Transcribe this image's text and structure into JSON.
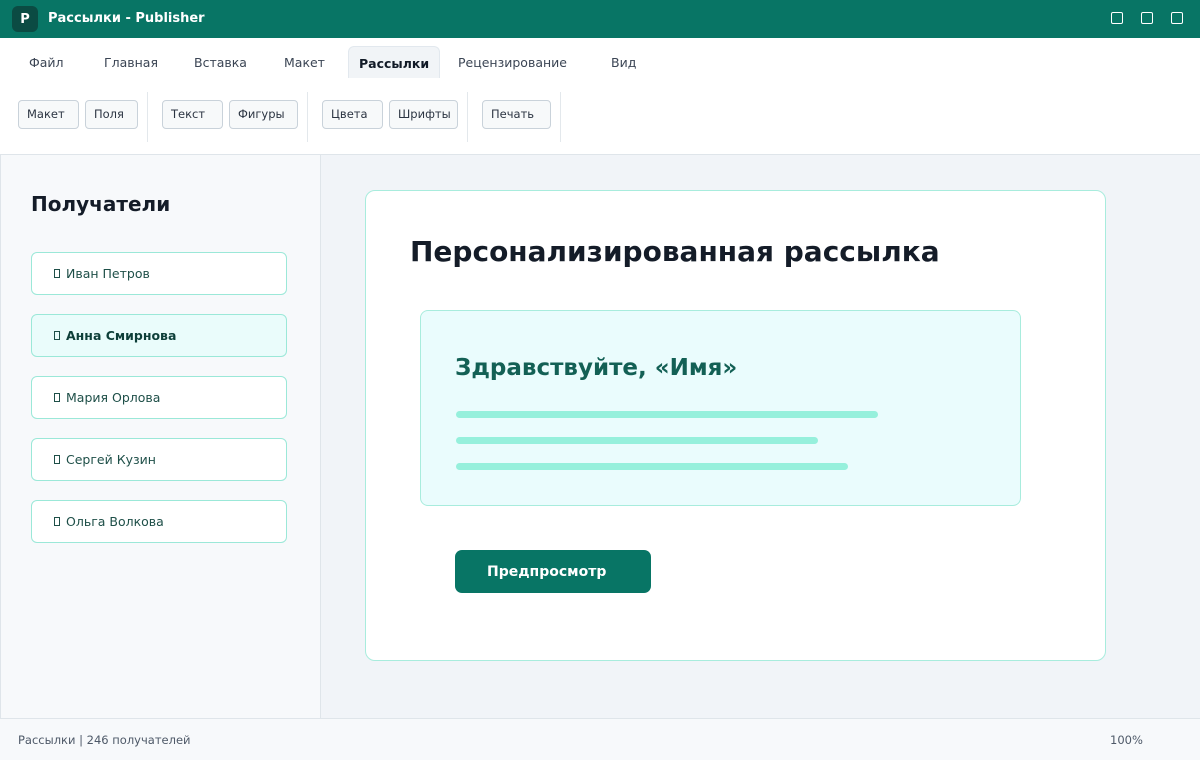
{
  "window": {
    "logo_letter": "P",
    "title": "Рассылки - Publisher"
  },
  "ribbon": {
    "tabs": [
      "Файл",
      "Главная",
      "Вставка",
      "Макет",
      "Рассылки",
      "Рецензирование",
      "Вид"
    ],
    "active_tab": "Рассылки",
    "groups": [
      [
        "Макет",
        "Поля"
      ],
      [
        "Текст",
        "Фигуры"
      ],
      [
        "Цвета",
        "Шрифты"
      ],
      [
        "Печать"
      ]
    ]
  },
  "sidebar": {
    "title": "Получатели",
    "recipients": [
      {
        "name": "Иван Петров",
        "icon": "contact-icon"
      },
      {
        "name": "Анна Смирнова",
        "icon": "contact-icon",
        "selected": true
      },
      {
        "name": "Мария Орлова",
        "icon": "contact-icon"
      },
      {
        "name": "Сергей Кузин",
        "icon": "contact-icon"
      },
      {
        "name": "Ольга Волкова",
        "icon": "contact-icon"
      }
    ]
  },
  "document": {
    "title": "Персонализированная рассылка",
    "greeting": "Здравствуйте, «Имя»",
    "preview_button": "Предпросмотр"
  },
  "status": {
    "text": "Рассылки | 246 получателей",
    "zoom": "100%"
  },
  "colors": {
    "brand": "#087565",
    "accent_light": "#96f0dc",
    "card_border": "#a8ecdd"
  }
}
